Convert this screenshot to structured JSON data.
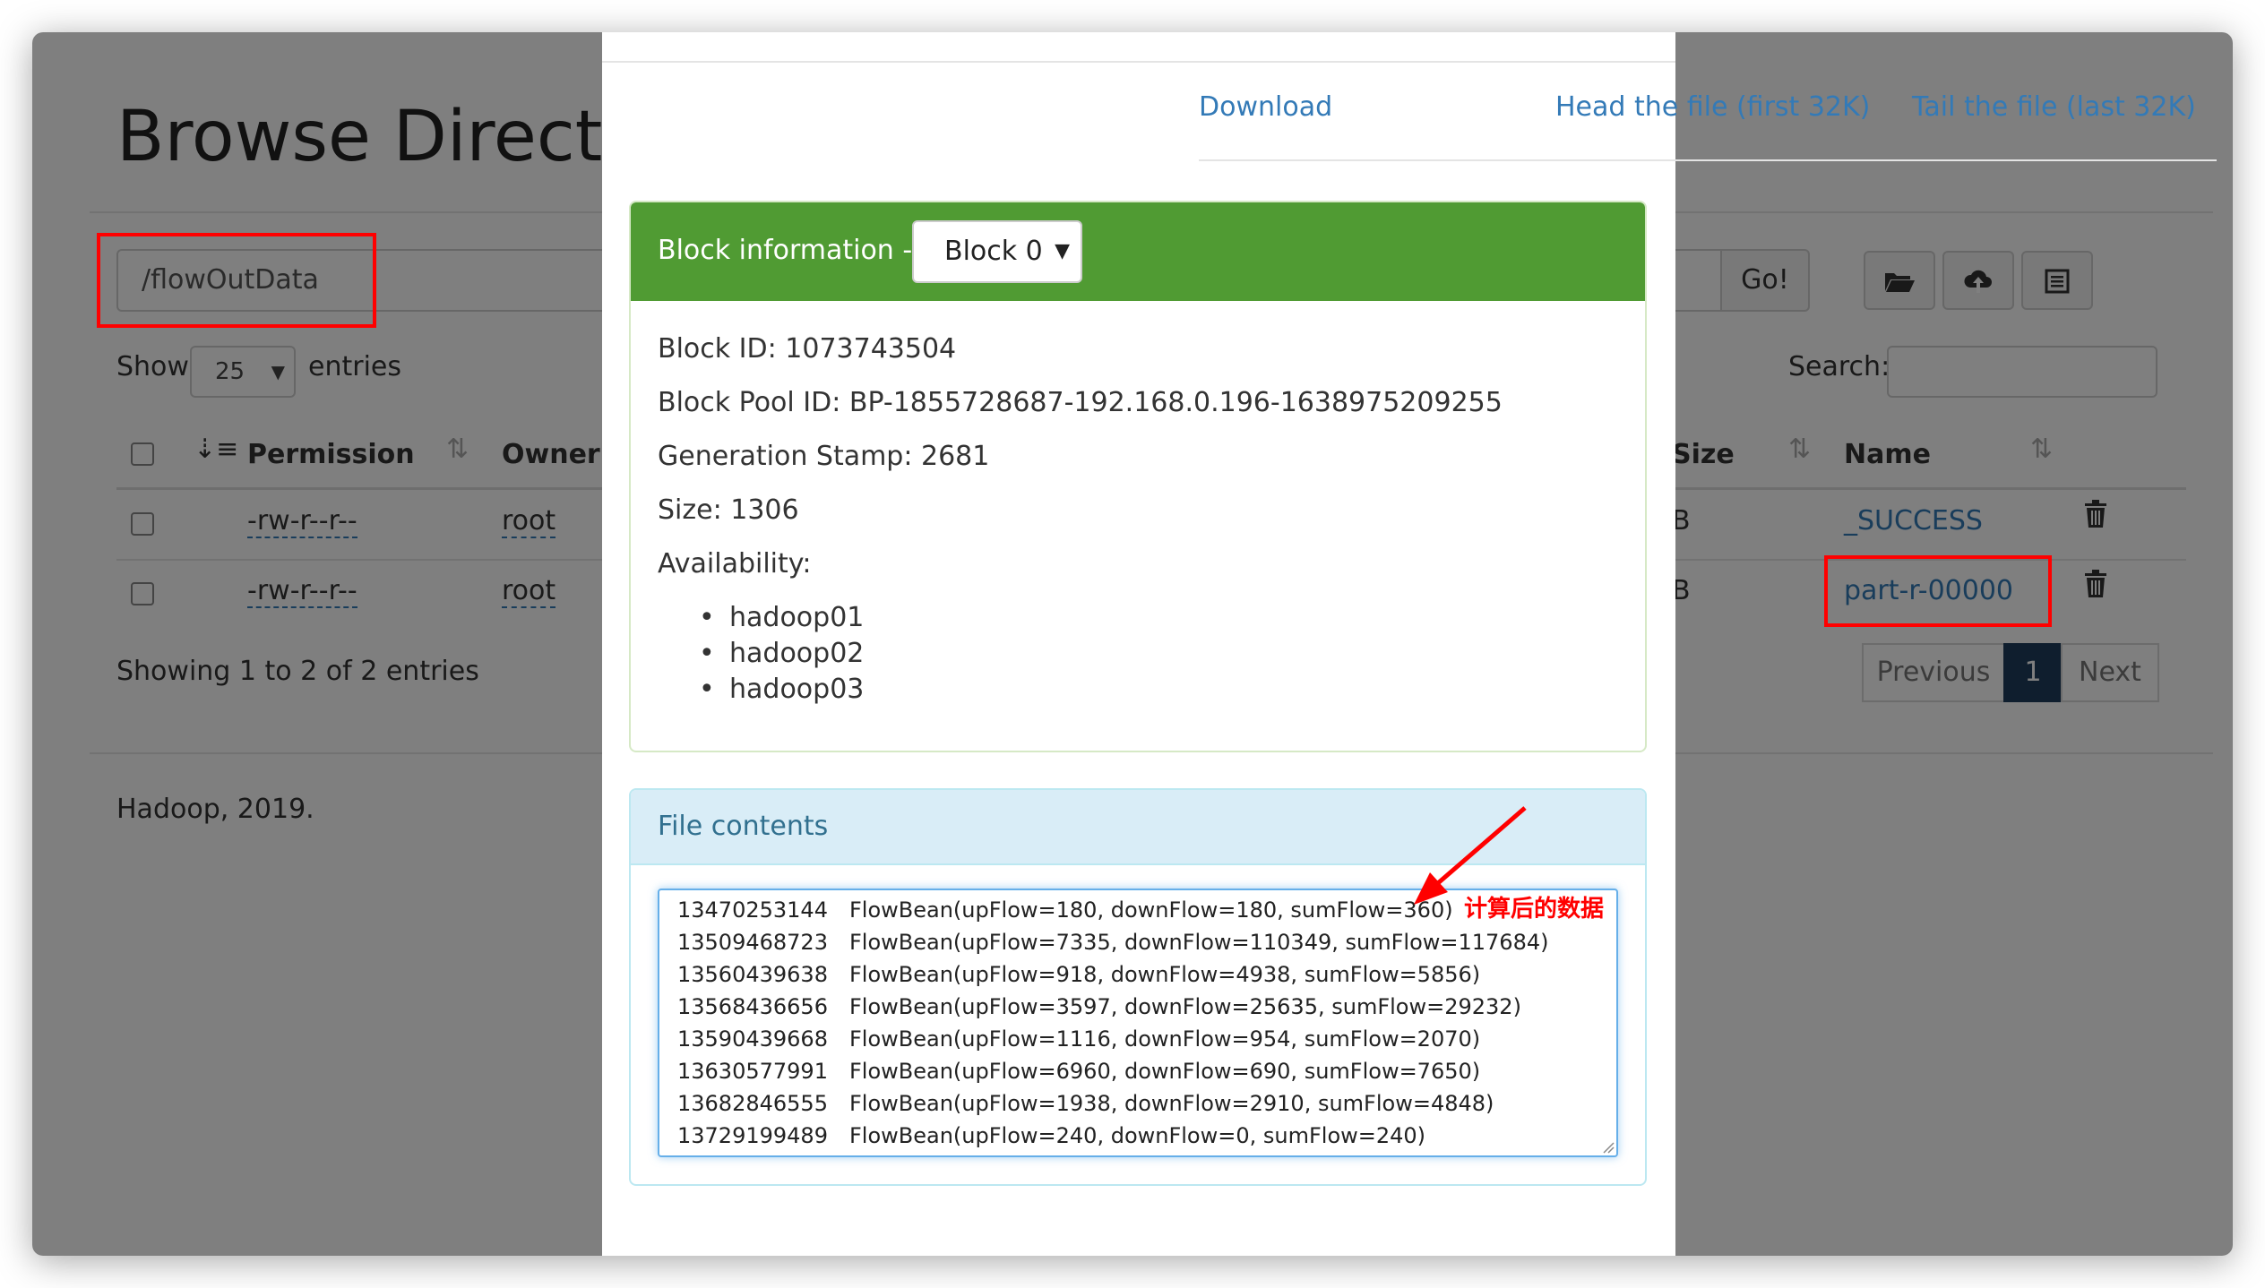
{
  "page": {
    "title": "Browse Director",
    "path_value": "/flowOutData",
    "go_label": "Go!",
    "show_label": "Show",
    "entries_value": "25",
    "entries_label": "entries",
    "search_label": "Search:",
    "search_value": "",
    "columns": {
      "permission": "Permission",
      "owner": "Owner",
      "size": "Size",
      "name": "Name"
    },
    "rows": [
      {
        "permission": "-rw-r--r--",
        "owner": "root",
        "size": "B",
        "name": "_SUCCESS"
      },
      {
        "permission": "-rw-r--r--",
        "owner": "root",
        "size": "B",
        "name": "part-r-00000"
      }
    ],
    "showing": "Showing 1 to 2 of 2 entries",
    "pager": {
      "previous": "Previous",
      "current": "1",
      "next": "Next"
    },
    "footer": "Hadoop, 2019."
  },
  "modal": {
    "download": "Download",
    "head": "Head the file (first 32K)",
    "tail": "Tail the file (last 32K)",
    "block_info_label": "Block information --",
    "block_selected": "Block 0",
    "block_id": "Block ID: 1073743504",
    "block_pool_id": "Block Pool ID: BP-1855728687-192.168.0.196-1638975209255",
    "generation_stamp": "Generation Stamp: 2681",
    "size": "Size: 1306",
    "availability_label": "Availability:",
    "availability": [
      "hadoop01",
      "hadoop02",
      "hadoop03"
    ],
    "file_contents_label": "File contents",
    "file_lines": [
      {
        "phone": "13470253144",
        "bean": "FlowBean(upFlow=180, downFlow=180, sumFlow=360)"
      },
      {
        "phone": "13509468723",
        "bean": "FlowBean(upFlow=7335, downFlow=110349, sumFlow=117684)"
      },
      {
        "phone": "13560439638",
        "bean": "FlowBean(upFlow=918, downFlow=4938, sumFlow=5856)"
      },
      {
        "phone": "13568436656",
        "bean": "FlowBean(upFlow=3597, downFlow=25635, sumFlow=29232)"
      },
      {
        "phone": "13590439668",
        "bean": "FlowBean(upFlow=1116, downFlow=954, sumFlow=2070)"
      },
      {
        "phone": "13630577991",
        "bean": "FlowBean(upFlow=6960, downFlow=690, sumFlow=7650)"
      },
      {
        "phone": "13682846555",
        "bean": "FlowBean(upFlow=1938, downFlow=2910, sumFlow=4848)"
      },
      {
        "phone": "13729199489",
        "bean": "FlowBean(upFlow=240, downFlow=0, sumFlow=240)"
      }
    ]
  },
  "annotation": {
    "text": "计算后的数据",
    "color": "#ff0000"
  },
  "icons": {
    "folder": "folder-open-icon",
    "upload": "cloud-upload-icon",
    "list": "list-icon",
    "trash": "trash-icon",
    "sort": "sort-icon"
  },
  "colors": {
    "panel_success": "#509b33",
    "panel_info_bg": "#d9edf7",
    "link": "#337ab7",
    "pager_active": "#1e3d5c"
  }
}
